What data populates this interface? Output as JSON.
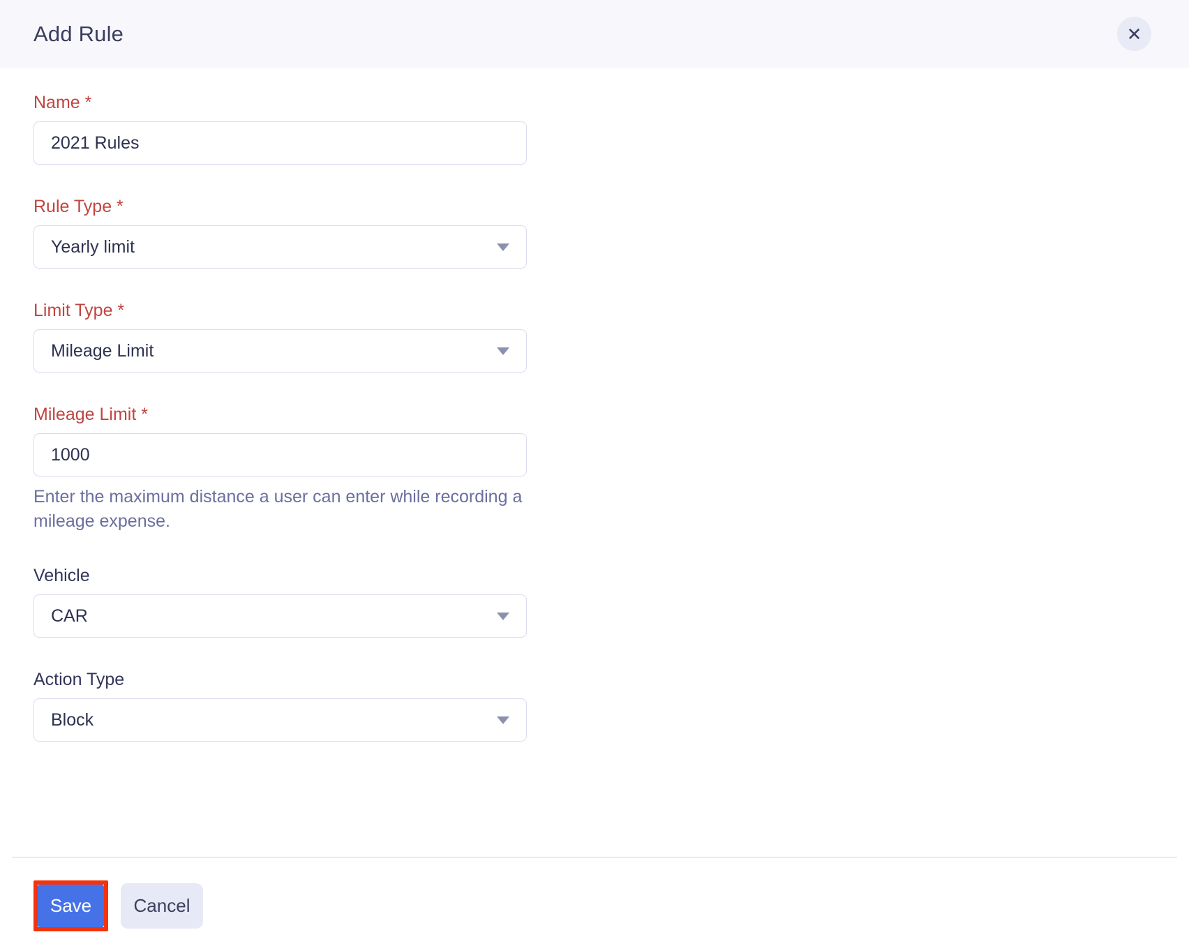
{
  "modal": {
    "title": "Add Rule",
    "close_glyph": "✕"
  },
  "form": {
    "fields": [
      {
        "label": "Name",
        "required_mark": " *",
        "type": "input",
        "value": "2021 Rules"
      },
      {
        "label": "Rule Type",
        "required_mark": " *",
        "type": "select",
        "value": "Yearly limit"
      },
      {
        "label": "Limit Type",
        "required_mark": " *",
        "type": "select",
        "value": "Mileage Limit"
      },
      {
        "label": "Mileage Limit",
        "required_mark": " *",
        "type": "input",
        "value": "1000",
        "helper": "Enter the maximum distance a user can enter while recording a mileage expense."
      },
      {
        "label": "Vehicle",
        "type": "select",
        "value": "CAR"
      },
      {
        "label": "Action Type",
        "type": "select",
        "value": "Block"
      }
    ]
  },
  "footer": {
    "save_label": "Save",
    "cancel_label": "Cancel"
  },
  "colors": {
    "header_bg": "#f7f7fc",
    "required_label_red": "#c04540",
    "label_navy": "#32355a",
    "input_border": "#d9dcec",
    "helper_text": "#6b6f9e",
    "primary_button_blue": "#4573e7",
    "annotation_highlight_red": "#f2330d",
    "cancel_button_bg": "#e7e9f6",
    "divider": "#eaebf5"
  }
}
